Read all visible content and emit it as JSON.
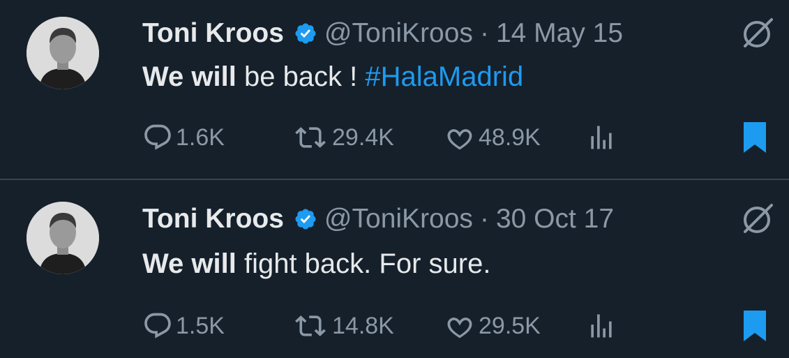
{
  "tweets": [
    {
      "author": {
        "name": "Toni Kroos",
        "handle": "@ToniKroos",
        "verified": true
      },
      "separator": "·",
      "date": "14 May 15",
      "text": {
        "bold": "We will",
        "plain": " be back ! ",
        "hashtag": "#HalaMadrid"
      },
      "stats": {
        "replies": "1.6K",
        "retweets": "29.4K",
        "likes": "48.9K"
      },
      "bookmarked": true
    },
    {
      "author": {
        "name": "Toni Kroos",
        "handle": "@ToniKroos",
        "verified": true
      },
      "separator": "·",
      "date": "30 Oct 17",
      "text": {
        "bold": "We will",
        "plain": " fight back. For sure.",
        "hashtag": ""
      },
      "stats": {
        "replies": "1.5K",
        "retweets": "14.8K",
        "likes": "29.5K"
      },
      "bookmarked": true
    }
  ],
  "icons": {
    "verified": "verified-badge-icon",
    "grok": "grok-icon",
    "reply": "reply-icon",
    "retweet": "retweet-icon",
    "like": "heart-icon",
    "views": "views-icon",
    "bookmark": "bookmark-icon"
  },
  "colors": {
    "background": "#15202b",
    "text": "#e7e9ea",
    "muted": "#8b98a5",
    "accent": "#1d9bf0",
    "divider": "#38444d"
  }
}
